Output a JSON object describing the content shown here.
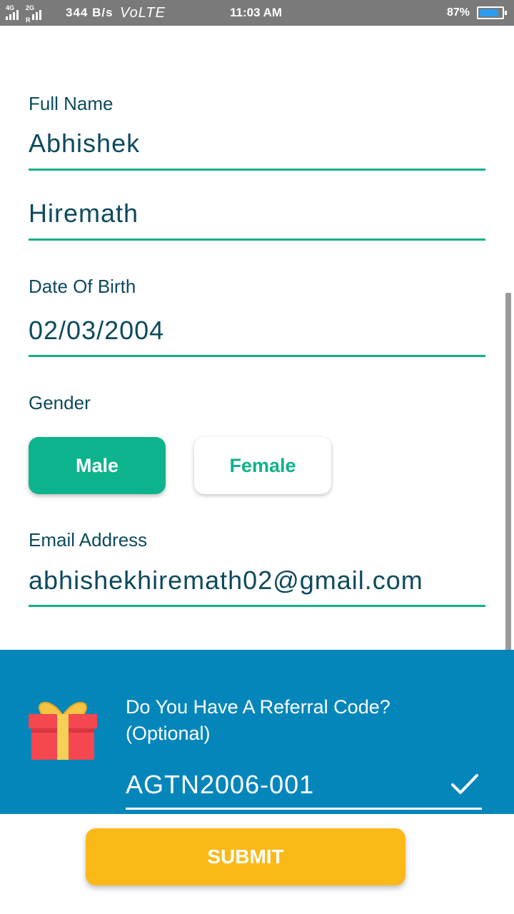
{
  "status_bar": {
    "network_1": "4G",
    "network_2": "2G",
    "network_2_sub": "R",
    "speed": "344 B/s",
    "volte": "VoLTE",
    "time": "11:03 AM",
    "battery_pct": "87%",
    "battery_level": 0.87
  },
  "form": {
    "full_name_label": "Full Name",
    "first_name": "Abhishek",
    "last_name": "Hiremath",
    "dob_label": "Date Of Birth",
    "dob": "02/03/2004",
    "gender_label": "Gender",
    "gender_options": [
      "Male",
      "Female"
    ],
    "gender_selected": "Male",
    "email_label": "Email Address",
    "email": "abhishekhiremath02@gmail.com"
  },
  "referral": {
    "question_line1": "Do You Have A Referral Code?",
    "question_line2": "(Optional)",
    "code": "AGTN2006-001",
    "icon": "gift-icon",
    "status_icon": "check-icon"
  },
  "actions": {
    "submit_label": "SUBMIT"
  },
  "colors": {
    "accent": "#0db38c",
    "text": "#0d4a5c",
    "referral_bg": "#0586bb",
    "submit_bg": "#fbb917",
    "status_bar_bg": "#7a7a7a"
  }
}
